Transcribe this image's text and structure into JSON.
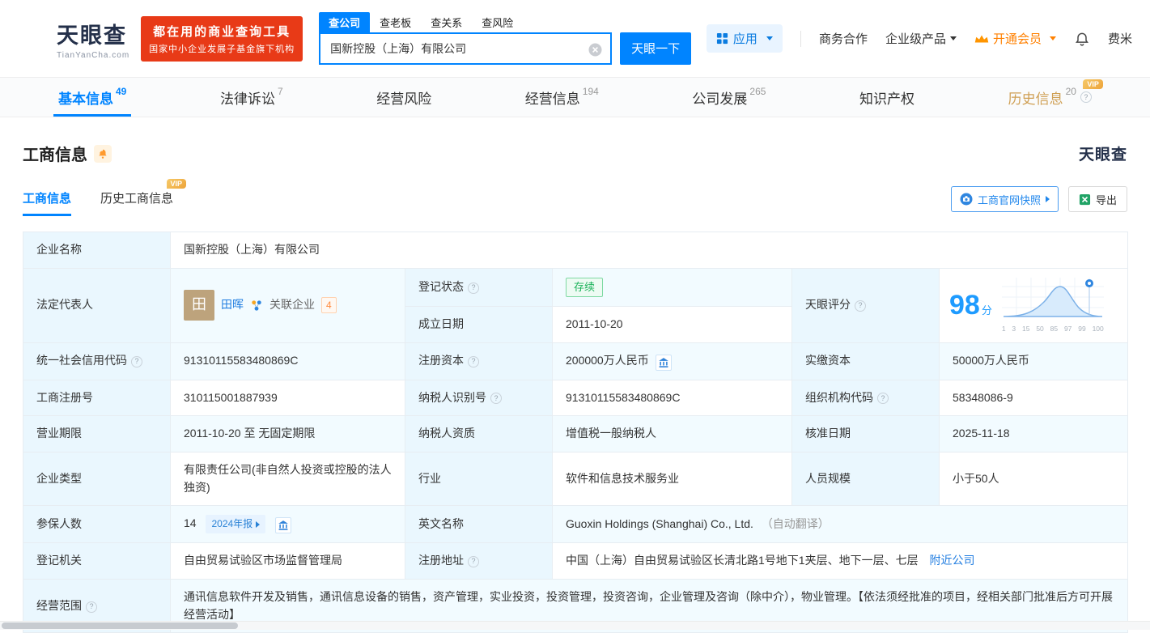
{
  "colors": {
    "brand_blue": "#0084ff",
    "link_blue": "#1f7ce0",
    "promo_red": "#e83a17",
    "vip_gold": "#eda43a",
    "history_gold_text": "#cf9f53",
    "status_green": "#1cb35a",
    "member_orange": "#ff8000",
    "score_blue": "#1e9bff"
  },
  "icons": {
    "help": "?"
  },
  "badges": {
    "vip": "VIP"
  },
  "header": {
    "logo": {
      "brand": "天眼查",
      "domain": "TianYanCha.com"
    },
    "promo": {
      "line1": "都在用的商业查询工具",
      "line2": "国家中小企业发展子基金旗下机构"
    },
    "search": {
      "tabs": [
        {
          "label": "查公司",
          "active": true
        },
        {
          "label": "查老板"
        },
        {
          "label": "查关系"
        },
        {
          "label": "查风险"
        }
      ],
      "value": "国新控股（上海）有限公司",
      "button": "天眼一下"
    },
    "menu": {
      "apps": "应用",
      "business": "商务合作",
      "enterprise": "企业级产品",
      "vip": "开通会员",
      "user": "费米"
    }
  },
  "nav": {
    "tabs": [
      {
        "label": "基本信息",
        "count": "49",
        "active": true
      },
      {
        "label": "法律诉讼",
        "count": "7"
      },
      {
        "label": "经营风险"
      },
      {
        "label": "经营信息",
        "count": "194"
      },
      {
        "label": "公司发展",
        "count": "265"
      },
      {
        "label": "知识产权"
      },
      {
        "label": "历史信息",
        "count": "20",
        "vip": true
      }
    ]
  },
  "section": {
    "title": "工商信息",
    "brand": "天眼查",
    "tabs": [
      {
        "label": "工商信息",
        "active": true
      },
      {
        "label": "历史工商信息",
        "vip": true
      }
    ],
    "actions": {
      "snapshot": "工商官网快照",
      "export": "导出"
    }
  },
  "table": {
    "company_name_label": "企业名称",
    "company_name": "国新控股（上海）有限公司",
    "legal_rep_label": "法定代表人",
    "legal_rep_avatar": "田",
    "legal_rep_name": "田晖",
    "related_label": "关联企业",
    "related_count": "4",
    "status_label": "登记状态",
    "status_value": "存续",
    "score_label": "天眼评分",
    "established_label": "成立日期",
    "established_value": "2011-10-20",
    "uscc_label": "统一社会信用代码",
    "uscc_value": "91310115583480869C",
    "reg_capital_label": "注册资本",
    "reg_capital_value": "200000万人民币",
    "paid_capital_label": "实缴资本",
    "paid_capital_value": "50000万人民币",
    "reg_no_label": "工商注册号",
    "reg_no_value": "310115001887939",
    "taxpayer_id_label": "纳税人识别号",
    "taxpayer_id_value": "91310115583480869C",
    "org_code_label": "组织机构代码",
    "org_code_value": "58348086-9",
    "term_label": "营业期限",
    "term_value": "2011-10-20 至 无固定期限",
    "taxpayer_quality_label": "纳税人资质",
    "taxpayer_quality_value": "增值税一般纳税人",
    "approval_date_label": "核准日期",
    "approval_date_value": "2025-11-18",
    "company_type_label": "企业类型",
    "company_type_value": "有限责任公司(非自然人投资或控股的法人独资)",
    "industry_label": "行业",
    "industry_value": "软件和信息技术服务业",
    "staff_size_label": "人员规模",
    "staff_size_value": "小于50人",
    "insured_label": "参保人数",
    "insured_value": "14",
    "annual_report_badge": "2024年报",
    "english_name_label": "英文名称",
    "english_name_value": "Guoxin Holdings (Shanghai) Co., Ltd.",
    "english_name_note": "（自动翻译）",
    "registry_label": "登记机关",
    "registry_value": "自由贸易试验区市场监督管理局",
    "address_label": "注册地址",
    "address_value": "中国（上海）自由贸易试验区长清北路1号地下1夹层、地下一层、七层",
    "nearby_link": "附近公司",
    "scope_label": "经营范围",
    "scope_value": "通讯信息软件开发及销售，通讯信息设备的销售，资产管理，实业投资，投资管理，投资咨询，企业管理及咨询（除中介），物业管理。【依法须经批准的项目，经相关部门批准后方可开展经营活动】"
  },
  "score_chart": {
    "type": "area",
    "score": "98",
    "unit": "分",
    "ticks": [
      "1",
      "3",
      "15",
      "50",
      "85",
      "97",
      "99",
      "100"
    ]
  }
}
